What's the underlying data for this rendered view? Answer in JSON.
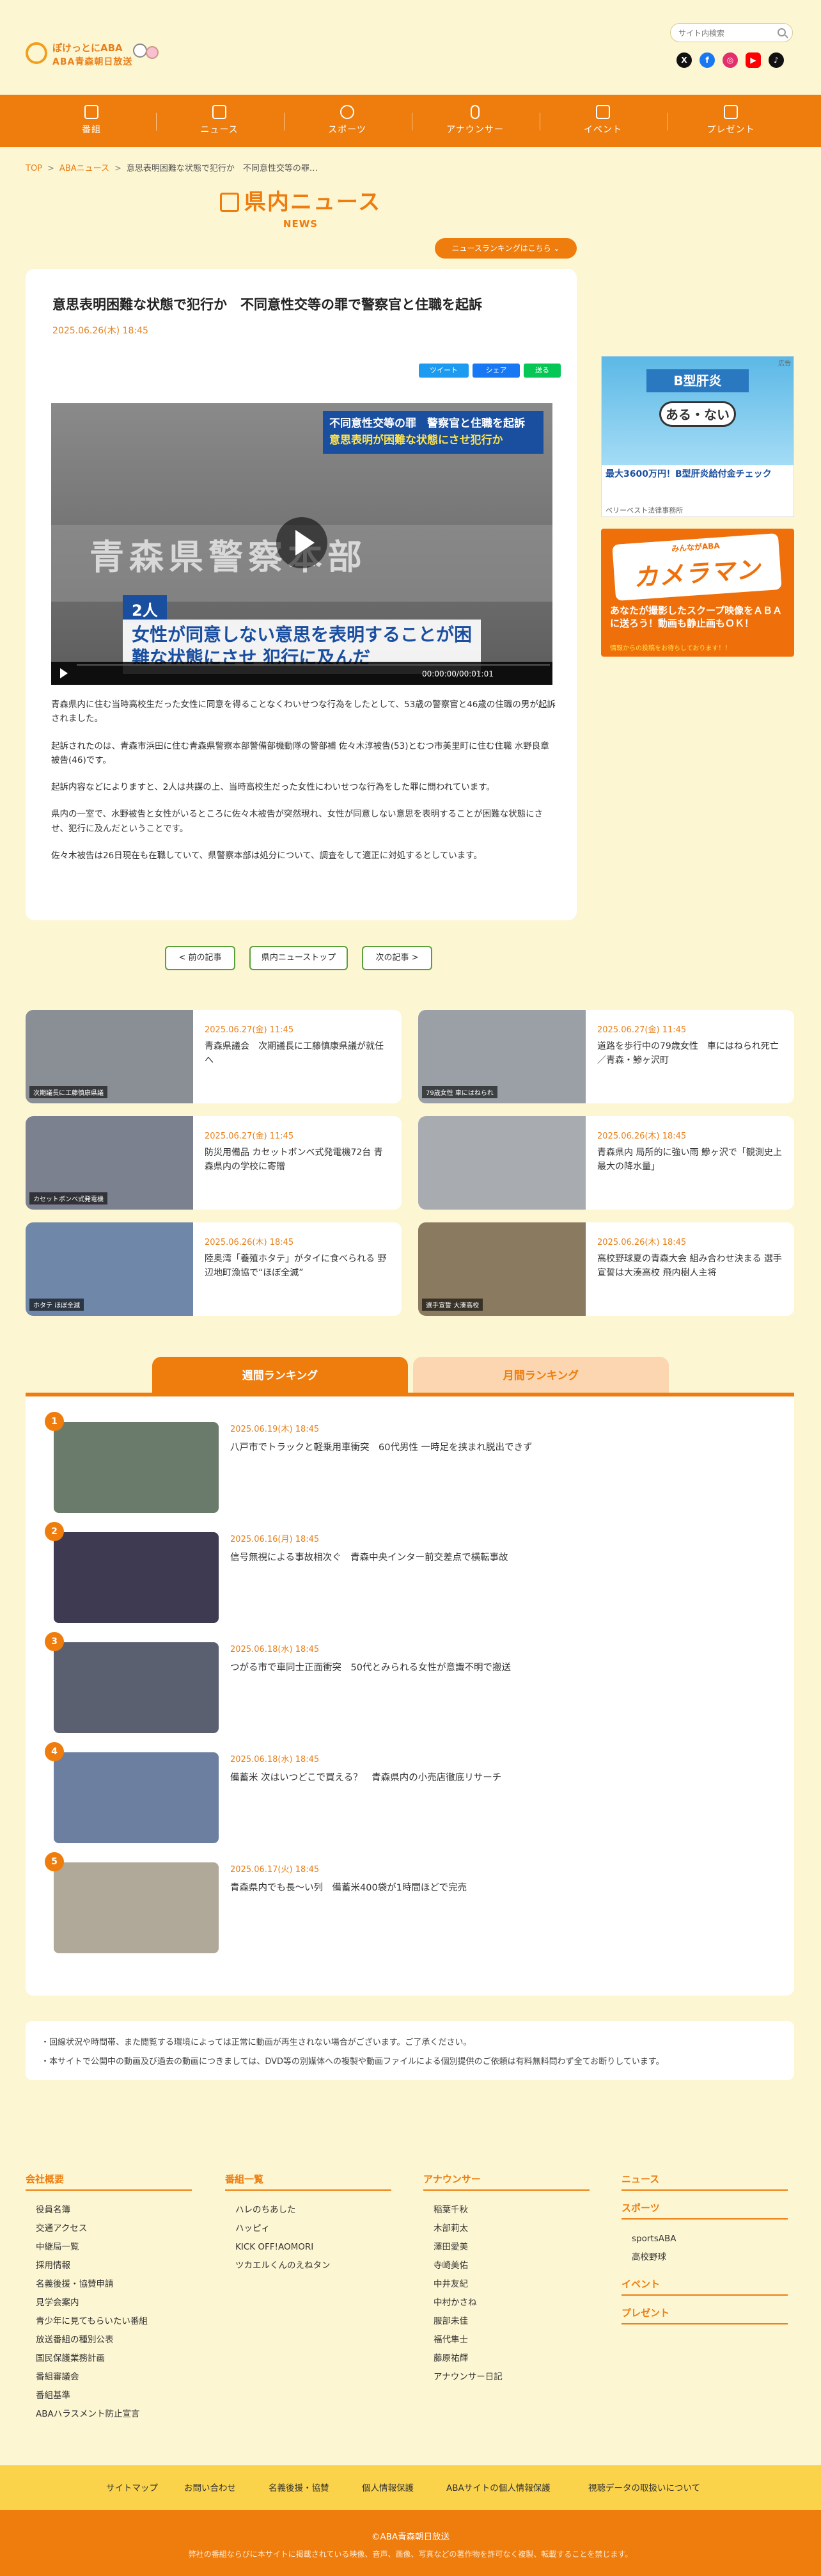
{
  "header": {
    "logo_line1": "ぽけっとにABA",
    "logo_line2": "ABA青森朝日放送",
    "search_placeholder": "サイト内検索",
    "socials": [
      {
        "icon": "x-icon",
        "glyph": "X",
        "color": "#111111"
      },
      {
        "icon": "facebook-icon",
        "glyph": "f",
        "color": "#1877f2"
      },
      {
        "icon": "instagram-icon",
        "glyph": "◎",
        "color": "#e1306c"
      },
      {
        "icon": "youtube-icon",
        "glyph": "▶",
        "color": "#ff0000"
      },
      {
        "icon": "tiktok-icon",
        "glyph": "♪",
        "color": "#111111"
      }
    ]
  },
  "nav": {
    "items": [
      {
        "label": "番組",
        "icon": "tv-icon"
      },
      {
        "label": "ニュース",
        "icon": "newspaper-icon"
      },
      {
        "label": "スポーツ",
        "icon": "ball-icon"
      },
      {
        "label": "アナウンサー",
        "icon": "microphone-icon"
      },
      {
        "label": "イベント",
        "icon": "calendar-icon"
      },
      {
        "label": "プレゼント",
        "icon": "gift-icon"
      }
    ]
  },
  "breadcrumb": {
    "home": "TOP",
    "news": "ABAニュース",
    "current": "意思表明困難な状態で犯行か　不同意性交等の罪…"
  },
  "section": {
    "title": "県内ニュース",
    "subtitle": "NEWS",
    "ranking_link": "ニュースランキングはこちら"
  },
  "article": {
    "title": "意思表明困難な状態で犯行か　不同意性交等の罪で警察官と住職を起訴",
    "date": "2025.06.26(木) 18:45",
    "share": {
      "twitter": "ツイート",
      "facebook": "シェア",
      "line": "送る"
    },
    "video": {
      "top_caption_1": "不同意性交等の罪　警察官と住職を起訴",
      "top_caption_2": "意思表明が困難な状態にさせ犯行か",
      "wall_sign": "青森県警察本部",
      "tag": "2人",
      "bottom_caption": "女性が同意しない意思を表明することが困難な状態にさせ 犯行に及んだ",
      "time": "00:00:00/00:01:01"
    },
    "paragraphs": [
      "青森県内に住む当時高校生だった女性に同意を得ることなくわいせつな行為をしたとして、53歳の警察官と46歳の住職の男が起訴されました。",
      "起訴されたのは、青森市浜田に住む青森県警察本部警備部機動隊の警部補 佐々木淳被告(53)とむつ市美里町に住む住職 水野良章被告(46)です。",
      "起訴内容などによりますと、2人は共謀の上、当時高校生だった女性にわいせつな行為をした罪に問われています。",
      "県内の一室で、水野被告と女性がいるところに佐々木被告が突然現れ、女性が同意しない意思を表明することが困難な状態にさせ、犯行に及んだということです。",
      "佐々木被告は26日現在も在職していて、県警察本部は処分について、調査をして適正に対処するとしています。"
    ]
  },
  "pager": {
    "prev": "< 前の記事",
    "top": "県内ニューストップ",
    "next": "次の記事 >"
  },
  "ads": {
    "ad_label": "広告",
    "ad1_box": "B型肝炎",
    "ad1_big": "ある・ない",
    "ad1_text": "最大3600万円！B型肝炎給付金チェック",
    "ad1_source": "ベリーベスト法律事務所",
    "ad2_small": "みんながABA",
    "ad2_big": "カメラマン",
    "ad2_text": "あなたが撮影したスクープ映像をＡＢＡに送ろう！動画も静止画もＯＫ！",
    "ad2_note": "情報からの投稿をお待ちしております！！"
  },
  "related_news": [
    {
      "date": "2025.06.27(金) 11:45",
      "title": "青森県議会　次期議長に工藤慎康県議が就任へ",
      "caption": "次期議長に工藤慎康県議",
      "thumb": "#8a8f96"
    },
    {
      "date": "2025.06.27(金) 11:45",
      "title": "道路を歩行中の79歳女性　車にはねられ死亡／青森・鯵ヶ沢町",
      "caption": "79歳女性 車にはねられ",
      "thumb": "#9aa0a6"
    },
    {
      "date": "2025.06.27(金) 11:45",
      "title": "防災用備品 カセットボンベ式発電機72台 青森県内の学校に寄贈",
      "caption": "カセットボンベ式発電機",
      "thumb": "#7c8190"
    },
    {
      "date": "2025.06.26(木) 18:45",
      "title": "青森県内 局所的に強い雨 鰺ヶ沢で「観測史上最大の降水量」",
      "caption": "",
      "thumb": "#a8acb0"
    },
    {
      "date": "2025.06.26(木) 18:45",
      "title": "陸奥湾「養殖ホタテ」がタイに食べられる 野辺地町漁協で“ほぼ全滅”",
      "caption": "ホタテ ほぼ全滅",
      "thumb": "#6f87a8"
    },
    {
      "date": "2025.06.26(木) 18:45",
      "title": "高校野球夏の青森大会 組み合わせ決まる 選手宣誓は大湊高校 飛内樹人主将",
      "caption": "選手宣誓 大湊高校",
      "thumb": "#8a7a60"
    }
  ],
  "ranking": {
    "tab_weekly": "週間ランキング",
    "tab_monthly": "月間ランキング",
    "items": [
      {
        "rank": "1",
        "date": "2025.06.19(木) 18:45",
        "title": "八戸市でトラックと軽乗用車衝突　60代男性 一時足を挟まれ脱出できず",
        "thumb": "#6b7b6b"
      },
      {
        "rank": "2",
        "date": "2025.06.16(月) 18:45",
        "title": "信号無視による事故相次ぐ　青森中央インター前交差点で横転事故",
        "thumb": "#3d3a52"
      },
      {
        "rank": "3",
        "date": "2025.06.18(水) 18:45",
        "title": "つがる市で車同士正面衝突　50代とみられる女性が意識不明で搬送",
        "thumb": "#5b6070"
      },
      {
        "rank": "4",
        "date": "2025.06.18(水) 18:45",
        "title": "備蓄米 次はいつどこで買える？　青森県内の小売店徹底リサーチ",
        "thumb": "#6c7fa0"
      },
      {
        "rank": "5",
        "date": "2025.06.17(火) 18:45",
        "title": "青森県内でも長〜い列　備蓄米400袋が1時間ほどで完売",
        "thumb": "#b0a898"
      }
    ]
  },
  "notice": {
    "line1": "・回線状況や時間帯、また閲覧する環境によっては正常に動画が再生されない場合がございます。ご了承ください。",
    "line2": "・本サイトで公開中の動画及び過去の動画につきましては、DVD等の別媒体への複製や動画ファイルによる個別提供のご依頼は有料無料問わず全てお断りしています。"
  },
  "footer": {
    "col1_title": "会社概要",
    "col1": [
      "役員名簿",
      "交通アクセス",
      "中継局一覧",
      "採用情報",
      "名義後援・協賛申請",
      "見学会案内",
      "青少年に見てもらいたい番組",
      "放送番組の種別公表",
      "国民保護業務計画",
      "番組審議会",
      "番組基準",
      "ABAハラスメント防止宣言"
    ],
    "col2_title": "番組一覧",
    "col2": [
      "ハレのちあした",
      "ハッピィ",
      "KICK OFF!AOMORI",
      "ツカエルくんのえねタン"
    ],
    "col3_title": "アナウンサー",
    "col3": [
      "稲葉千秋",
      "木部莉太",
      "澤田愛美",
      "寺崎美佑",
      "中井友紀",
      "中村かさね",
      "服部未佳",
      "福代隼士",
      "藤原祐輝",
      "アナウンサー日記"
    ],
    "col4_title1": "ニュース",
    "col4_title2": "スポーツ",
    "col4_sports": [
      "sportsABA",
      "高校野球"
    ],
    "col4_title3": "イベント",
    "col4_title4": "プレゼント",
    "bar": [
      "サイトマップ",
      "お問い合わせ",
      "名義後援・協賛",
      "個人情報保護",
      "ABAサイトの個人情報保護",
      "視聴データの取扱いについて"
    ],
    "copyright": "©ABA青森朝日放送",
    "copyright_note": "弊社の番組ならびに本サイトに掲載されている映像、音声、画像、写真などの著作物を許可なく複製、転載することを禁じます。"
  }
}
